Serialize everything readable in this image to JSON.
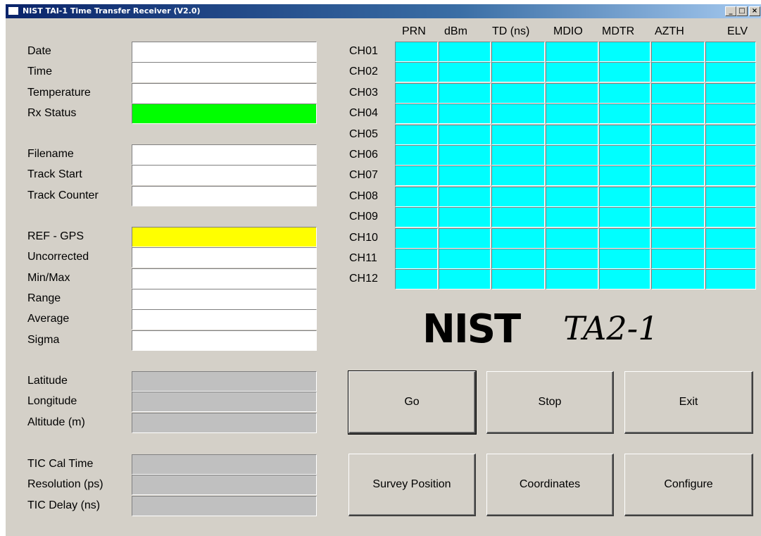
{
  "window": {
    "title": "NIST TAI-1 Time Transfer Receiver (V2.0)",
    "minimize_glyph": "_",
    "maximize_glyph": "□",
    "close_glyph": "×"
  },
  "status_panel": {
    "group1": [
      {
        "label": "Date",
        "value": "",
        "color": "#ffffff"
      },
      {
        "label": "Time",
        "value": "",
        "color": "#ffffff"
      },
      {
        "label": "Temperature",
        "value": "",
        "color": "#ffffff"
      },
      {
        "label": "Rx Status",
        "value": "",
        "color": "#00ff00"
      }
    ],
    "group2": [
      {
        "label": "Filename",
        "value": "",
        "color": "#ffffff"
      },
      {
        "label": "Track Start",
        "value": "",
        "color": "#ffffff"
      },
      {
        "label": "Track Counter",
        "value": "",
        "color": "#ffffff"
      }
    ],
    "group3": [
      {
        "label": "REF - GPS",
        "value": "",
        "color": "#ffff00"
      },
      {
        "label": "Uncorrected",
        "value": "",
        "color": "#ffffff"
      },
      {
        "label": "Min/Max",
        "value": "",
        "color": "#ffffff"
      },
      {
        "label": "Range",
        "value": "",
        "color": "#ffffff"
      },
      {
        "label": "Average",
        "value": "",
        "color": "#ffffff"
      },
      {
        "label": "Sigma",
        "value": "",
        "color": "#ffffff"
      }
    ],
    "group4": [
      {
        "label": "Latitude",
        "value": "",
        "color": "#c0c0c0"
      },
      {
        "label": "Longitude",
        "value": "",
        "color": "#c0c0c0"
      },
      {
        "label": "Altitude (m)",
        "value": "",
        "color": "#c0c0c0"
      }
    ],
    "group5": [
      {
        "label": "TIC Cal Time",
        "value": "",
        "color": "#c0c0c0"
      },
      {
        "label": "Resolution (ps)",
        "value": "",
        "color": "#c0c0c0"
      },
      {
        "label": "TIC Delay (ns)",
        "value": "",
        "color": "#c0c0c0"
      }
    ]
  },
  "channel_table": {
    "columns": [
      "PRN",
      "dBm",
      "TD (ns)",
      "MDIO",
      "MDTR",
      "AZTH",
      "ELV"
    ],
    "rows": [
      "CH01",
      "CH02",
      "CH03",
      "CH04",
      "CH05",
      "CH06",
      "CH07",
      "CH08",
      "CH09",
      "CH10",
      "CH11",
      "CH12"
    ],
    "cell_color": "#00ffff"
  },
  "logo": {
    "brand": "NIST",
    "product": "TA2-1"
  },
  "buttons": {
    "go": "Go",
    "stop": "Stop",
    "exit": "Exit",
    "survey_position": "Survey Position",
    "coordinates": "Coordinates",
    "configure": "Configure"
  }
}
